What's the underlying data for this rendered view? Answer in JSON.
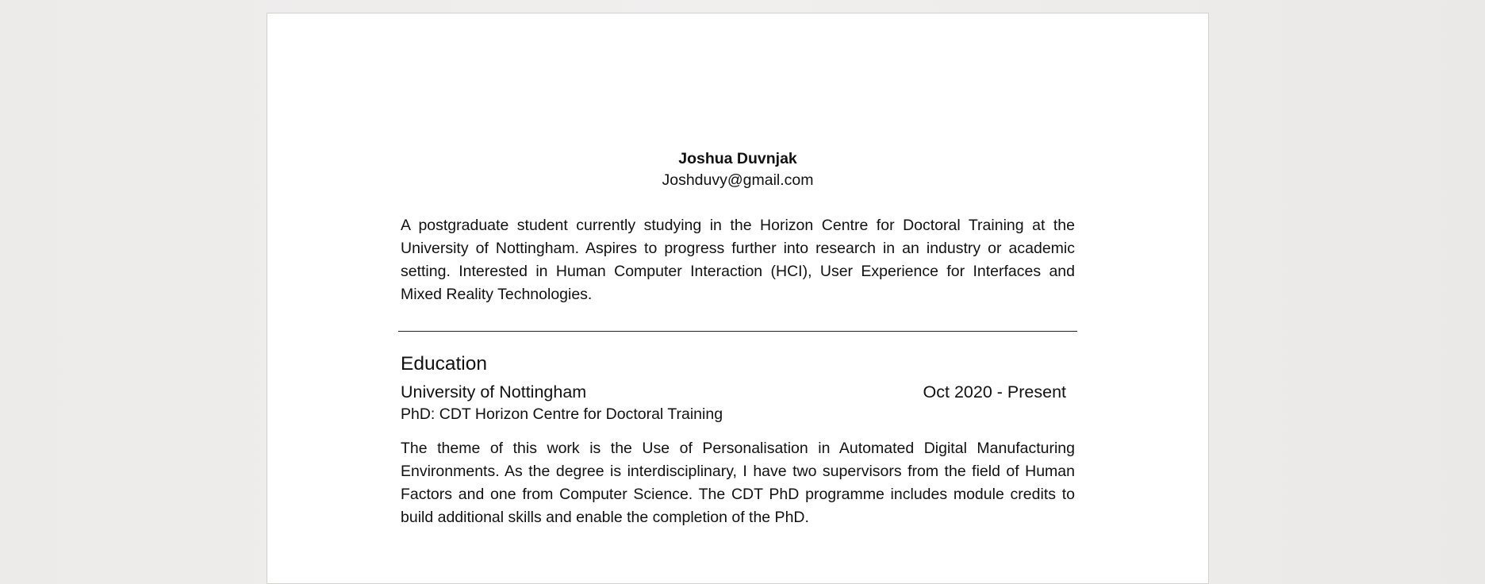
{
  "header": {
    "name": "Joshua Duvnjak",
    "email": "Joshduvy@gmail.com"
  },
  "summary": "A postgraduate student currently studying in the Horizon Centre for Doctoral Training at the University of Nottingham. Aspires to progress further into research in an industry or academic setting. Interested in Human Computer Interaction (HCI), User Experience for Interfaces and Mixed Reality Technologies.",
  "education": {
    "heading": "Education",
    "entries": [
      {
        "institution": "University of Nottingham",
        "dates": "Oct 2020 - Present",
        "degree": "PhD: CDT Horizon Centre for Doctoral Training",
        "description": "The theme of this work is the Use of Personalisation in Automated Digital Manufacturing Environments. As the degree is interdisciplinary, I have two supervisors from the field of Human Factors and one from Computer Science. The CDT PhD programme includes module credits to build additional skills and enable the completion of the PhD."
      }
    ]
  }
}
